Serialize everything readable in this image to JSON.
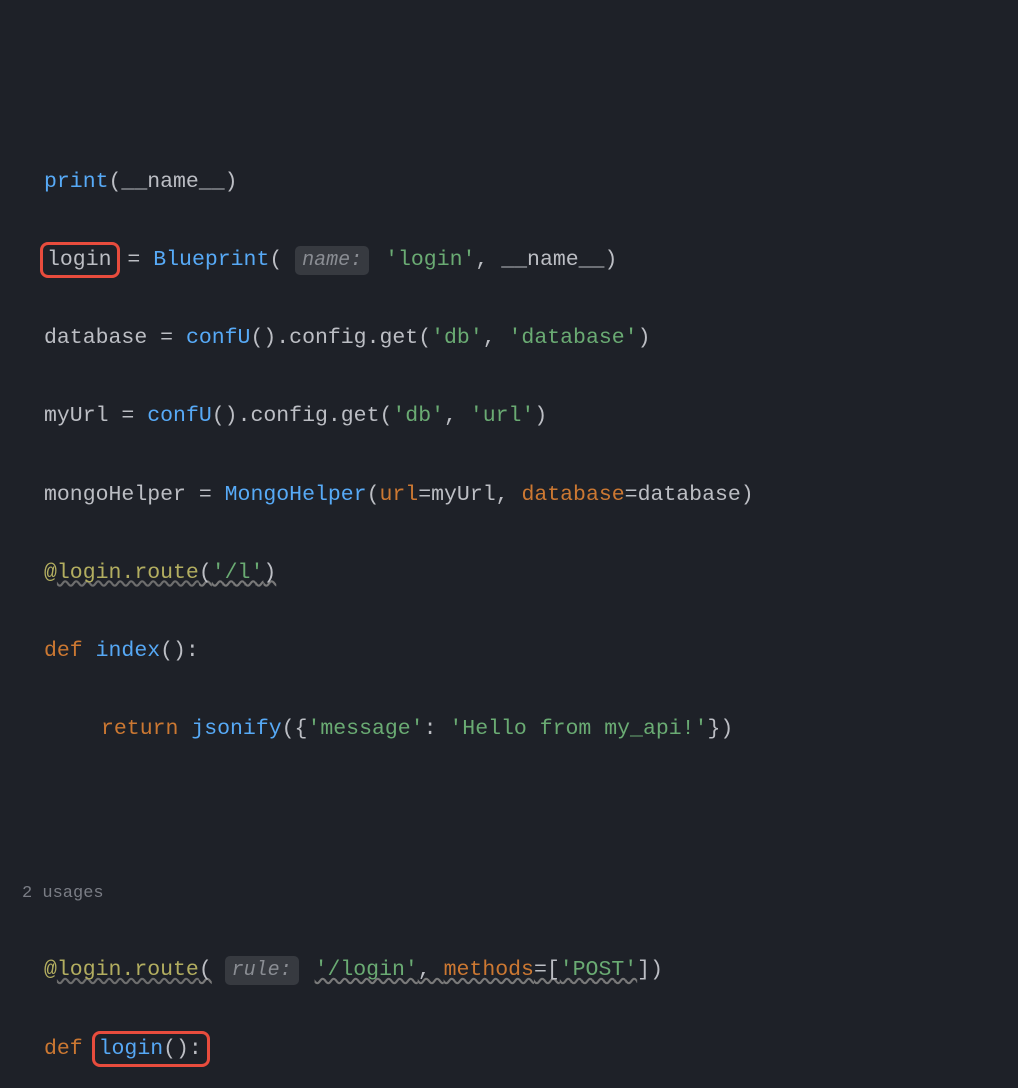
{
  "lines": {
    "l1_print": "print",
    "l1_dunder_name": "__name__",
    "l2_login_var": "login",
    "l2_eq": " = ",
    "l2_blueprint": "Blueprint",
    "l2_hint_name": "name:",
    "l2_str_login": "'login'",
    "l2_dunder_name": "__name__",
    "l3_database": "database",
    "l3_eq": " = ",
    "l3_confu": "confU",
    "l3_config_get": ".config.get",
    "l3_str_db": "'db'",
    "l3_str_database": "'database'",
    "l4_myurl": "myUrl",
    "l4_eq": " = ",
    "l4_confu": "confU",
    "l4_config_get": ".config.get",
    "l4_str_db": "'db'",
    "l4_str_url": "'url'",
    "l5_mh": "mongoHelper",
    "l5_eq": " = ",
    "l5_MH": "MongoHelper",
    "l5_url_kw": "url",
    "l5_myurl": "myUrl",
    "l5_db_kw": "database",
    "l5_db_val": "database",
    "l6_decor_at": "@",
    "l6_login_route": "login.route",
    "l6_str_l": "'/l'",
    "l7_def": "def ",
    "l7_index": "index",
    "l8_return": "return ",
    "l8_jsonify": "jsonify",
    "l8_str_msg": "'message'",
    "l8_str_hello": "'Hello from my_api!'",
    "usages": "2 usages",
    "l9_decor_at": "@",
    "l9_login_route": "login.route",
    "l9_hint_rule": "rule:",
    "l9_str_login": "'/login'",
    "l9_methods": "methods",
    "l9_str_post": "'POST'",
    "l10_def": "def ",
    "l10_login": "login",
    "l10_pp": "():"
  },
  "colors": {
    "bg": "#1e2128",
    "text": "#bcbec4",
    "func": "#57aaf7",
    "string": "#6aab73",
    "keyword": "#cc7832",
    "decorator": "#b3ae60",
    "redbox": "#e84c3d"
  }
}
